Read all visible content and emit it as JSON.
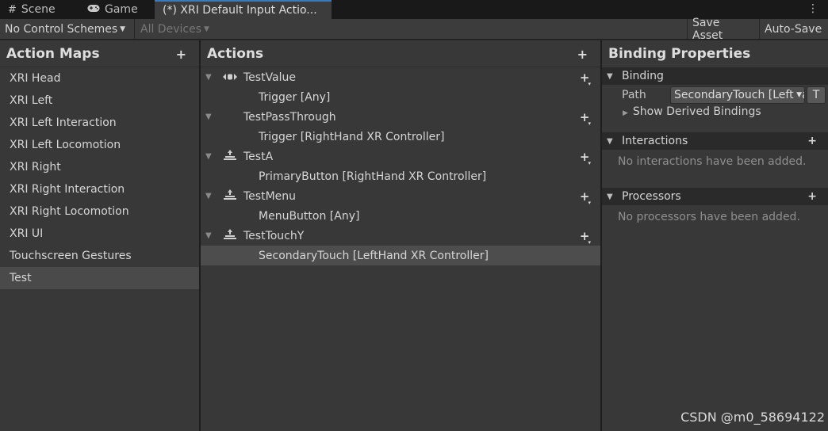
{
  "tabs": [
    {
      "icon": "grid-icon",
      "glyph": "#",
      "label": "Scene"
    },
    {
      "icon": "gamepad-icon",
      "glyph": "🎮",
      "label": "Game"
    },
    {
      "icon": "",
      "glyph": "",
      "label": "(*) XRI Default Input Actio..."
    }
  ],
  "toolbar": {
    "control_schemes": "No Control Schemes",
    "devices": "All Devices",
    "save_asset": "Save Asset",
    "auto_save": "Auto-Save"
  },
  "action_maps": {
    "title": "Action Maps",
    "items": [
      "XRI Head",
      "XRI Left",
      "XRI Left Interaction",
      "XRI Left Locomotion",
      "XRI Right",
      "XRI Right Interaction",
      "XRI Right Locomotion",
      "XRI UI",
      "Touchscreen Gestures",
      "Test"
    ],
    "selected": "Test"
  },
  "actions": {
    "title": "Actions",
    "rows": [
      {
        "kind": "action",
        "name": "TestValue",
        "icon": "value-icon"
      },
      {
        "kind": "binding",
        "name": "Trigger [Any]"
      },
      {
        "kind": "action",
        "name": "TestPassThrough",
        "icon": ""
      },
      {
        "kind": "binding",
        "name": "Trigger [RightHand XR Controller]"
      },
      {
        "kind": "action",
        "name": "TestA",
        "icon": "button-icon"
      },
      {
        "kind": "binding",
        "name": "PrimaryButton [RightHand XR Controller]"
      },
      {
        "kind": "action",
        "name": "TestMenu",
        "icon": "button-icon"
      },
      {
        "kind": "binding",
        "name": "MenuButton [Any]"
      },
      {
        "kind": "action",
        "name": "TestTouchY",
        "icon": "button-icon"
      },
      {
        "kind": "binding",
        "name": "SecondaryTouch [LeftHand XR Controller]",
        "selected": true
      }
    ]
  },
  "binding_properties": {
    "title": "Binding Properties",
    "binding_section": "Binding",
    "path_label": "Path",
    "path_value": "SecondaryTouch [LeftHand XR Controller]",
    "t_button": "T",
    "derived_label": "Show Derived Bindings",
    "interactions_section": "Interactions",
    "interactions_empty": "No interactions have been added.",
    "processors_section": "Processors",
    "processors_empty": "No processors have been added."
  },
  "watermark": "CSDN @m0_58694122"
}
